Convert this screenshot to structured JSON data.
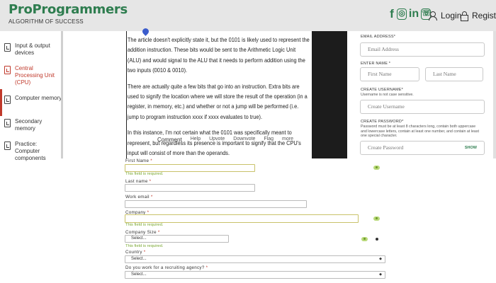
{
  "brand": {
    "name": "ProProgrammers",
    "tagline": "ALGORITHM OF SUCCESS",
    "color": "#2e7d4f"
  },
  "header": {
    "social_icons": [
      "facebook-icon",
      "instagram-icon",
      "linkedin-icon",
      "whatsapp-icon"
    ],
    "login": "Login",
    "register": "Register"
  },
  "sidebar": {
    "items": [
      {
        "label": "Input & output devices",
        "active": false
      },
      {
        "label": "Central Processing Unit (CPU)",
        "active": true
      },
      {
        "label": "Computer memory",
        "active": false
      },
      {
        "label": "Secondary memory",
        "active": false
      },
      {
        "label": "Practice: Computer components",
        "active": false
      }
    ]
  },
  "article": {
    "paragraphs": [
      "The article doesn't explicitly state it, but the 0101 is likely used to represent the addition instruction. These bits would be sent to the Arithmetic Logic Unit (ALU) and would signal to the ALU that it needs to perform addition using the two inputs (0010 & 0010).",
      "There are actually quite a few bits that go into an instruction. Extra bits are used to signify the location where we will store the result of the operation (in a register, in memory, etc.) and whether or not a jump will be performed (i.e. jump to program instruction xxxx if xxxx evaluates to true).",
      "In this instance, I'm not certain what the 0101 was specifically meant to represent, but regardless its presence is important to signify that the CPU's input will consist of more than the operands."
    ],
    "toolbar": [
      "Comment",
      "Help",
      "Upvote",
      "Downvote",
      "Flag",
      "more"
    ]
  },
  "signup": {
    "email_label": "EMAIL ADDRESS*",
    "email_placeholder": "Email Address",
    "name_label": "ENTER NAME *",
    "first_placeholder": "First Name",
    "last_placeholder": "Last Name",
    "username_label": "CREATE USERNAME*",
    "username_hint": "Username is not case sensitive.",
    "username_placeholder": "Create Username",
    "password_label": "CREATE PASSWORD*",
    "password_hint": "Password must be at least 8 characters long, contain both uppercase and lowercase letters, contain at least one number, and contain at least one special character.",
    "password_placeholder": "Create Password",
    "show": "SHOW"
  },
  "lead_form": {
    "first_name_label": "First Name",
    "last_name_label": "Last name",
    "work_email_label": "Work email",
    "company_label": "Company",
    "company_size_label": "Company Size",
    "country_label": "Country",
    "recruiting_label": "Do you work for a recruiting agency?",
    "required_mark": "*",
    "required_error": "This field is required.",
    "select_placeholder": "Select..."
  }
}
